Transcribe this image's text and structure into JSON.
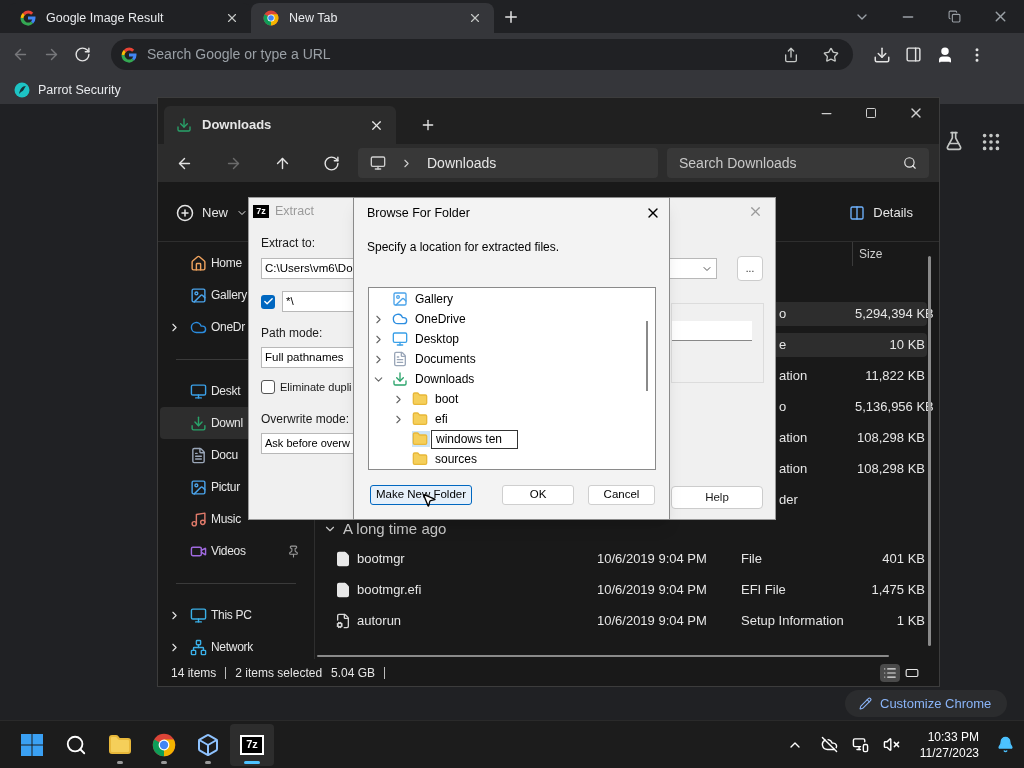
{
  "browser": {
    "tabs": [
      {
        "title": "Google Image Result",
        "kind": "google",
        "selected": false
      },
      {
        "title": "New Tab",
        "kind": "chrome",
        "selected": true
      }
    ],
    "nav_buttons": [
      {
        "kind": "back",
        "disabled": true
      },
      {
        "kind": "forward",
        "disabled": true
      },
      {
        "kind": "reload",
        "disabled": false
      }
    ],
    "omnibox": {
      "placeholder": "Search Google or type a URL"
    },
    "bookmarks": [
      "Parrot Security"
    ],
    "customize_button": "Customize Chrome"
  },
  "explorer": {
    "tabs": [
      {
        "title": "Downloads",
        "selected": true
      }
    ],
    "nav_buttons": [
      {
        "kind": "back",
        "disabled": false
      },
      {
        "kind": "forward",
        "disabled": true
      },
      {
        "kind": "up",
        "disabled": false
      },
      {
        "kind": "refresh",
        "disabled": false
      }
    ],
    "address": "Downloads",
    "search": {
      "placeholder": "Search Downloads"
    },
    "new_button": "New",
    "details_button": "Details",
    "sidebar": [
      [
        {
          "label": "Home",
          "kind": "home",
          "expandable": false,
          "selected": false
        },
        {
          "label": "Gallery",
          "kind": "gallery",
          "expandable": false,
          "selected": false
        },
        {
          "label": "OneDr",
          "kind": "cloud",
          "expandable": true,
          "selected": false
        }
      ],
      [
        {
          "label": "Deskt",
          "kind": "desktop",
          "expandable": false,
          "selected": false
        },
        {
          "label": "Downl",
          "kind": "download",
          "expandable": false,
          "selected": true
        },
        {
          "label": "Docu",
          "kind": "document",
          "expandable": false,
          "selected": false
        },
        {
          "label": "Pictur",
          "kind": "pictures",
          "expandable": false,
          "selected": false
        },
        {
          "label": "Music",
          "kind": "music",
          "expandable": false,
          "selected": false
        },
        {
          "label": "Videos",
          "kind": "video",
          "expandable": false,
          "selected": false,
          "pinned": true
        }
      ],
      [
        {
          "label": "This PC",
          "kind": "pc",
          "expandable": true,
          "selected": false,
          "pinned": false
        },
        {
          "label": "Network",
          "kind": "network",
          "expandable": true,
          "selected": false,
          "pinned": false
        }
      ]
    ],
    "columns": [
      {
        "label": "Size"
      }
    ],
    "covered_rows": [
      {
        "type": "o",
        "size": "5,294,394 KB",
        "selected": true
      },
      {
        "type": "e",
        "size": "10 KB",
        "selected": true
      },
      {
        "type": "ation",
        "size": "11,822 KB",
        "selected": false
      },
      {
        "type": "o",
        "size": "5,136,956 KB",
        "selected": false
      },
      {
        "type": "ation",
        "size": "108,298 KB",
        "selected": false
      },
      {
        "type": "ation",
        "size": "108,298 KB",
        "selected": false
      },
      {
        "type": "der",
        "selected": false
      }
    ],
    "group": {
      "title": "A long time ago",
      "expanded": true,
      "rows": [
        {
          "name": "bootmgr",
          "kind": "file",
          "date": "10/6/2019 9:04 PM",
          "type": "File",
          "size": "401 KB",
          "selected": false
        },
        {
          "name": "bootmgr.efi",
          "kind": "file",
          "date": "10/6/2019 9:04 PM",
          "type": "EFI File",
          "size": "1,475 KB",
          "selected": false
        },
        {
          "name": "autorun",
          "kind": "settings",
          "date": "10/6/2019 9:04 PM",
          "type": "Setup Information",
          "size": "1 KB",
          "selected": false
        }
      ]
    },
    "status": {
      "items": "14 items",
      "selected": "2 items selected",
      "size": "5.04 GB"
    },
    "views": [
      {
        "kind": "details",
        "selected": true
      },
      {
        "kind": "tiles",
        "selected": false
      }
    ]
  },
  "extract_dialog": {
    "icon_text": "7z",
    "title": "Extract",
    "active": false,
    "extract_to": {
      "label": "Extract to:",
      "value": "C:\\Users\\vm6\\Do"
    },
    "subfolder": {
      "checked": true,
      "value": "*\\"
    },
    "path_mode": {
      "label": "Path mode:",
      "value": "Full pathnames"
    },
    "eliminate": {
      "label": "Eliminate dupli",
      "checked": false
    },
    "overwrite_mode": {
      "label": "Overwrite mode:",
      "value": "Ask before overw"
    },
    "browse_button": "...",
    "help_button": "Help"
  },
  "browse_dialog": {
    "title": "Browse For Folder",
    "description": "Specify a location for extracted files.",
    "tree": [
      {
        "label": "Gallery",
        "kind": "gallery",
        "expandable": false,
        "editing": false
      },
      {
        "label": "OneDrive",
        "kind": "cloud",
        "expandable": true,
        "expanded": false,
        "editing": false
      },
      {
        "label": "Desktop",
        "kind": "desktop",
        "expandable": true,
        "expanded": false,
        "editing": false
      },
      {
        "label": "Documents",
        "kind": "document",
        "expandable": true,
        "expanded": false,
        "editing": false
      },
      {
        "label": "Downloads",
        "kind": "download",
        "expandable": true,
        "expanded": true,
        "editing": false,
        "children": [
          {
            "label": "boot",
            "kind": "folder",
            "expandable": true,
            "expanded": false,
            "editing": false
          },
          {
            "label": "efi",
            "kind": "folder",
            "expandable": true,
            "expanded": false,
            "editing": false
          },
          {
            "label": "windows ten",
            "kind": "folder",
            "expandable": false,
            "editing": true
          },
          {
            "label": "sources",
            "kind": "folder",
            "expandable": false,
            "editing": false
          }
        ]
      }
    ],
    "buttons": [
      {
        "label": "Make New Folder",
        "focused": true
      },
      {
        "label": "OK",
        "focused": false
      },
      {
        "label": "Cancel",
        "focused": false
      }
    ]
  },
  "taskbar": {
    "apps": [
      {
        "kind": "start",
        "running": false,
        "active": false
      },
      {
        "kind": "search",
        "running": false,
        "active": false
      },
      {
        "kind": "explorer",
        "running": true,
        "active": false
      },
      {
        "kind": "chrome",
        "running": true,
        "active": false
      },
      {
        "kind": "box",
        "running": true,
        "active": false
      },
      {
        "kind": "archiver",
        "label": "7z",
        "running": true,
        "active": true
      }
    ],
    "time": "10:33 PM",
    "date": "11/27/2023"
  }
}
